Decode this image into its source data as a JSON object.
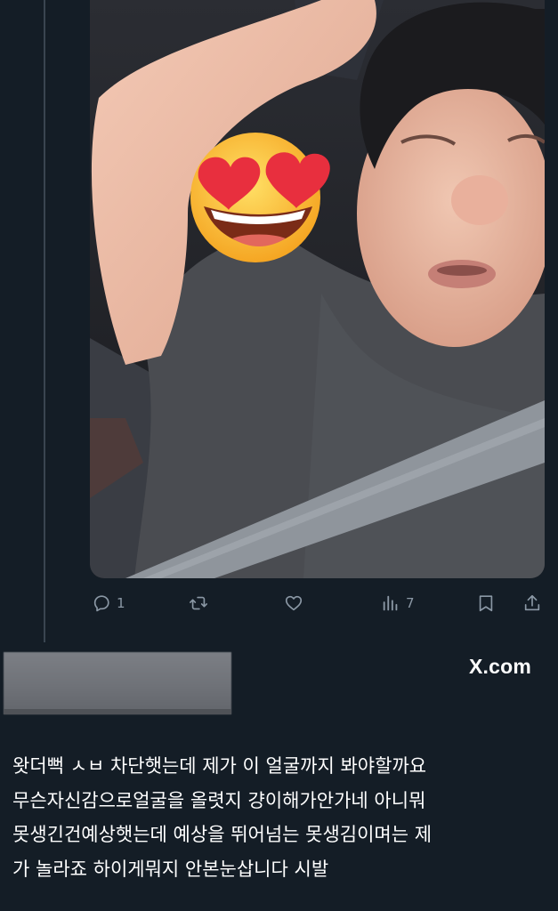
{
  "tweet": {
    "photo_overlay_emoji": "😍",
    "actions": {
      "reply_count": "1",
      "retweet_count": "",
      "like_count": "",
      "views_count": "7"
    },
    "icons": [
      "reply-icon",
      "retweet-icon",
      "like-icon",
      "views-icon",
      "bookmark-icon",
      "share-icon"
    ]
  },
  "watermark": "X.com",
  "caption_lines": [
    "왓더뻑 ㅅㅂ 차단햇는데 제가 이 얼굴까지 봐야할까요",
    "무슨자신감으로얼굴을 올렷지 걍이해가안가네 아니뭐",
    "못생긴건예상햇는데 예상을 뛰어넘는 못생김이며는 제",
    "가 놀라죠 하이게뭐지 안본눈삽니다 시발"
  ],
  "colors": {
    "background": "#141d26",
    "icon_gray": "#8b98a5",
    "text": "#ffffff"
  }
}
